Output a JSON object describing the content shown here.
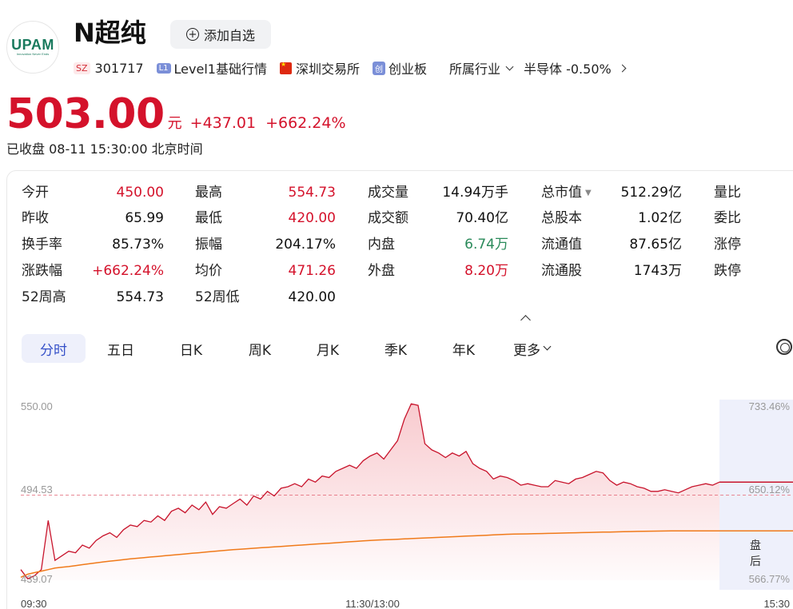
{
  "logo": {
    "text": "UPAM",
    "sub": "Innovation Never Ends"
  },
  "stock": {
    "name": "N超纯",
    "watch_label": "添加自选"
  },
  "meta": {
    "market_tag": "SZ",
    "code": "301717",
    "level_tag": "L1",
    "level_text": "Level1基础行情",
    "exchange": "深圳交易所",
    "board_tag": "创",
    "board": "创业板",
    "industry_label": "所属行业",
    "industry": "半导体 -0.50%"
  },
  "quote": {
    "price": "503.00",
    "unit": "元",
    "change": "+437.01",
    "change_pct": "+662.24%",
    "status": "已收盘 08-11 15:30:00 北京时间"
  },
  "stats": [
    [
      {
        "label": "今开",
        "value": "450.00",
        "color": "red"
      },
      {
        "label": "昨收",
        "value": "65.99",
        "color": "dark"
      },
      {
        "label": "换手率",
        "value": "85.73%",
        "color": "dark"
      },
      {
        "label": "涨跌幅",
        "value": "+662.24%",
        "color": "red"
      },
      {
        "label": "52周高",
        "value": "554.73",
        "color": "dark"
      }
    ],
    [
      {
        "label": "最高",
        "value": "554.73",
        "color": "red"
      },
      {
        "label": "最低",
        "value": "420.00",
        "color": "red"
      },
      {
        "label": "振幅",
        "value": "204.17%",
        "color": "dark"
      },
      {
        "label": "均价",
        "value": "471.26",
        "color": "red"
      },
      {
        "label": "52周低",
        "value": "420.00",
        "color": "dark"
      }
    ],
    [
      {
        "label": "成交量",
        "value": "14.94万手",
        "color": "dark"
      },
      {
        "label": "成交额",
        "value": "70.40亿",
        "color": "dark"
      },
      {
        "label": "内盘",
        "value": "6.74万",
        "color": "green"
      },
      {
        "label": "外盘",
        "value": "8.20万",
        "color": "red"
      }
    ],
    [
      {
        "label": "总市值",
        "value": "512.29亿",
        "color": "dark"
      },
      {
        "label": "总股本",
        "value": "1.02亿",
        "color": "dark"
      },
      {
        "label": "流通值",
        "value": "87.65亿",
        "color": "dark"
      },
      {
        "label": "流通股",
        "value": "1743万",
        "color": "dark"
      }
    ],
    [
      {
        "label": "量比"
      },
      {
        "label": "委比"
      },
      {
        "label": "涨停"
      },
      {
        "label": "跌停"
      }
    ]
  ],
  "tabs": [
    "分时",
    "五日",
    "日K",
    "周K",
    "月K",
    "季K",
    "年K",
    "更多"
  ],
  "chart_data": {
    "type": "line",
    "y_left_ticks": [
      "550.00",
      "494.53",
      "439.07"
    ],
    "y_right_ticks": [
      "733.46%",
      "650.12%",
      "566.77%"
    ],
    "x_ticks": [
      "09:30",
      "11:30/13:00",
      "15:30"
    ],
    "after_hours_label": "盘后",
    "ylim": [
      439.07,
      550.0
    ],
    "reference": 494.53,
    "series": [
      {
        "values": [
          446,
          440,
          442,
          446,
          478,
          452,
          455,
          458,
          457,
          462,
          460,
          465,
          468,
          470,
          467,
          472,
          475,
          474,
          478,
          477,
          481,
          478,
          484,
          486,
          483,
          488,
          485,
          490,
          482,
          487,
          486,
          489,
          492,
          488,
          494,
          492,
          497,
          494,
          499,
          500,
          502,
          500,
          505,
          503,
          507,
          506,
          510,
          512,
          514,
          512,
          517,
          520,
          522,
          518,
          524,
          530,
          544,
          554,
          553,
          528,
          524,
          522,
          519,
          522,
          520,
          523,
          515,
          512,
          510,
          505,
          507,
          506,
          504,
          501,
          502,
          501,
          500,
          500,
          504,
          503,
          502,
          505,
          506,
          508,
          510,
          509,
          504,
          501,
          503,
          502,
          500,
          499,
          497,
          497,
          498,
          497,
          496,
          498,
          500,
          501,
          502,
          501,
          503
        ]
      },
      {
        "values": [
          441,
          443,
          444,
          445,
          446,
          447,
          447.5,
          448,
          448.6,
          449.2,
          449.8,
          450.4,
          451,
          451.5,
          452,
          452.5,
          453,
          453.4,
          453.8,
          454.2,
          454.6,
          455,
          455.4,
          455.8,
          456.2,
          456.6,
          457,
          457.4,
          457.8,
          458.2,
          458.6,
          459,
          459.3,
          459.6,
          459.9,
          460.2,
          460.5,
          460.8,
          461.1,
          461.4,
          461.7,
          462,
          462.3,
          462.6,
          462.9,
          463.2,
          463.5,
          463.8,
          464.1,
          464.4,
          464.7,
          465,
          465.2,
          465.4,
          465.6,
          465.8,
          466,
          466.2,
          466.4,
          466.6,
          466.8,
          467,
          467.2,
          467.4,
          467.6,
          467.8,
          468,
          468.2,
          468.4,
          468.6,
          468.8,
          469,
          469.1,
          469.2,
          469.3,
          469.4,
          469.5,
          469.6,
          469.7,
          469.8,
          469.9,
          470,
          470.1,
          470.2,
          470.3,
          470.4,
          470.5,
          470.6,
          470.7,
          470.8,
          470.9,
          471,
          471.05,
          471.1,
          471.15,
          471.2,
          471.22,
          471.24,
          471.26,
          471.26,
          471.26,
          471.26,
          471.26
        ]
      }
    ]
  }
}
